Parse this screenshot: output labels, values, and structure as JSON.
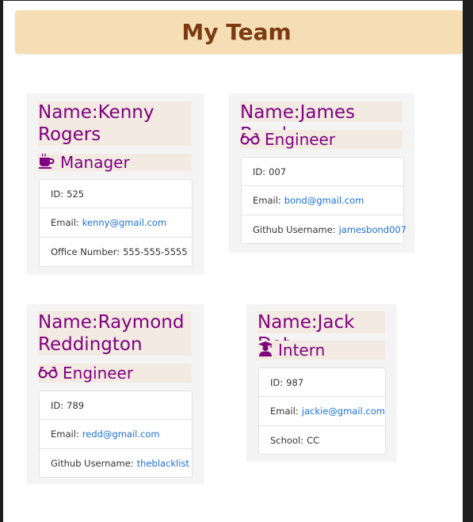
{
  "header": {
    "title": "My Team"
  },
  "cards": [
    {
      "name_prefix": "Name:",
      "name": "Kenny Rogers",
      "role": "Manager",
      "role_icon": "coffee-icon",
      "id_label": "ID:",
      "id": "525",
      "email_label": "Email:",
      "email": "kenny@gmail.com",
      "extra_label": "Office Number:",
      "extra": "555-555-5555"
    },
    {
      "name_prefix": "Name:",
      "name": "James Bond",
      "role": "Engineer",
      "role_icon": "glasses-icon",
      "id_label": "ID:",
      "id": "007",
      "email_label": "Email:",
      "email": "bond@gmail.com",
      "extra_label": "Github Username:",
      "extra": "jamesbond007"
    },
    {
      "name_prefix": "Name:",
      "name": "Raymond Reddington",
      "role": "Engineer",
      "role_icon": "glasses-icon",
      "id_label": "ID:",
      "id": "789",
      "email_label": "Email:",
      "email": "redd@gmail.com",
      "extra_label": "Github Username:",
      "extra": "theblacklist"
    },
    {
      "name_prefix": "Name:",
      "name": "Jack Dat",
      "role": "Intern",
      "role_icon": "graduate-icon",
      "id_label": "ID:",
      "id": "987",
      "email_label": "Email:",
      "email": "jackie@gmail.com",
      "extra_label": "School:",
      "extra": "CC"
    }
  ],
  "colors": {
    "header_bg": "#f5deb3",
    "header_text": "#7b3a12",
    "name_text": "#800080",
    "name_bg": "#f3ebe2",
    "link": "#1a6fd6"
  }
}
